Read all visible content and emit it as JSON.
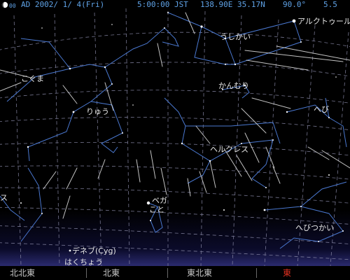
{
  "status": {
    "moon_phase_value": "00",
    "date": "AD 2002/ 1/ 4(Fri)",
    "time": "5:00:00 JST",
    "location": "138.90E 35.17N",
    "view_angle": "90.0°",
    "magnitude_limit": "5.5"
  },
  "constellations": {
    "arcturus": "アルクトゥール",
    "ushikai": "うしかい",
    "kokuma": "こぐま",
    "kanmuri": "かんむり",
    "ryuu": "りゅう",
    "hebi": "へび",
    "herakuresu": "ヘルクレス",
    "vega": "ベガ",
    "koto": "こと",
    "su": "ス",
    "hebitsukai": "へびつかい",
    "deneb": "デネブ(Cyg)",
    "hakuchou": "はくちょう"
  },
  "directions": {
    "nne": "北北東",
    "ne": "北東",
    "ene": "東北東",
    "e": "東"
  },
  "colors": {
    "sky": "#000000",
    "horizon_glow": "#2a2a6e",
    "grid": "#8a8aa8",
    "constellation_lines": "#4a78d0",
    "meteors": "#d8d8d8",
    "status_text": "#5fa2e6",
    "direction_text": "#c8c8c8",
    "east_highlight": "#e03020"
  }
}
